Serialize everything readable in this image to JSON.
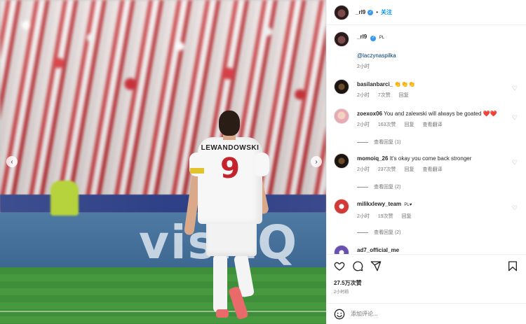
{
  "post": {
    "image": {
      "jersey_name": "LEWANDOWSKI",
      "jersey_number": "9",
      "ad_text": "visitQ"
    },
    "header": {
      "username": "_rl9",
      "follow_label": "关注"
    },
    "caption": {
      "username": "_rl9",
      "badge": "PL",
      "mention": "@laczynaspilka",
      "time": "2小时"
    },
    "comments": [
      {
        "username": "basilanbarci_",
        "text": "👏👏👏",
        "time": "2小时",
        "likes": "7次赞",
        "reply": "回复"
      },
      {
        "username": "zoexox06",
        "text": "You and zalewski will always be goated ❤️❤️",
        "time": "2小时",
        "likes": "163次赞",
        "reply": "回复",
        "translate": "查看翻译",
        "view_replies": "查看回复 (1)"
      },
      {
        "username": "momoiq_26",
        "text": "It's okay you come back stronger",
        "time": "2小时",
        "likes": "237次赞",
        "reply": "回复",
        "translate": "查看翻译",
        "view_replies": "查看回复 (2)"
      },
      {
        "username": "milikxlewy_team",
        "badge": "PL♥",
        "time": "2小时",
        "likes": "19次赞",
        "reply": "回复",
        "view_replies": "查看回复 (2)"
      },
      {
        "username": "ad7_official_me"
      }
    ],
    "footer": {
      "likes": "27.5万次赞",
      "time": "2小时前",
      "comment_placeholder": "添加评论..."
    }
  },
  "colors": {
    "accent": "#0095f6",
    "verified": "#3897f0",
    "heart": "#d12b3a"
  }
}
